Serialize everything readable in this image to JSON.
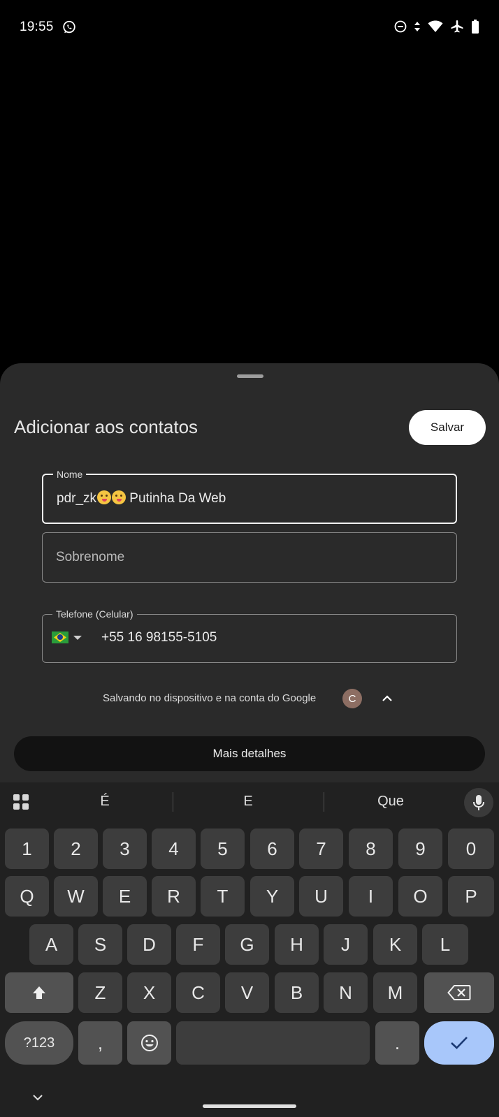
{
  "status_bar": {
    "time": "19:55",
    "left_icons": [
      "whatsapp-icon"
    ],
    "right_icons": [
      "do-not-disturb-icon",
      "data-arrows-icon",
      "wifi-icon",
      "airplane-icon",
      "battery-icon"
    ]
  },
  "sheet": {
    "title": "Adicionar aos contatos",
    "save_label": "Salvar",
    "fields": {
      "name": {
        "label": "Nome",
        "value_prefix": "pdr_zk",
        "value_suffix": " Putinha Da Web",
        "emoji_count": 2
      },
      "surname": {
        "placeholder": "Sobrenome"
      },
      "phone": {
        "label": "Telefone (Celular)",
        "country_flag": "brazil-flag-icon",
        "value": "+55 16 98155-5105"
      }
    },
    "account": {
      "text": "Salvando no dispositivo e na conta do Google",
      "avatar_letter": "C"
    },
    "more_details_label": "Mais detalhes"
  },
  "keyboard": {
    "suggestions": [
      "É",
      "E",
      "Que"
    ],
    "rows": [
      [
        "1",
        "2",
        "3",
        "4",
        "5",
        "6",
        "7",
        "8",
        "9",
        "0"
      ],
      [
        "Q",
        "W",
        "E",
        "R",
        "T",
        "Y",
        "U",
        "I",
        "O",
        "P"
      ],
      [
        "A",
        "S",
        "D",
        "F",
        "G",
        "H",
        "J",
        "K",
        "L"
      ],
      [
        "Z",
        "X",
        "C",
        "V",
        "B",
        "N",
        "M"
      ]
    ],
    "symbols_label": "?123",
    "comma_label": ",",
    "period_label": ".",
    "colors": {
      "enter_key": "#a8c7fa",
      "key": "#3d3d3d",
      "function_key": "#525252"
    }
  }
}
